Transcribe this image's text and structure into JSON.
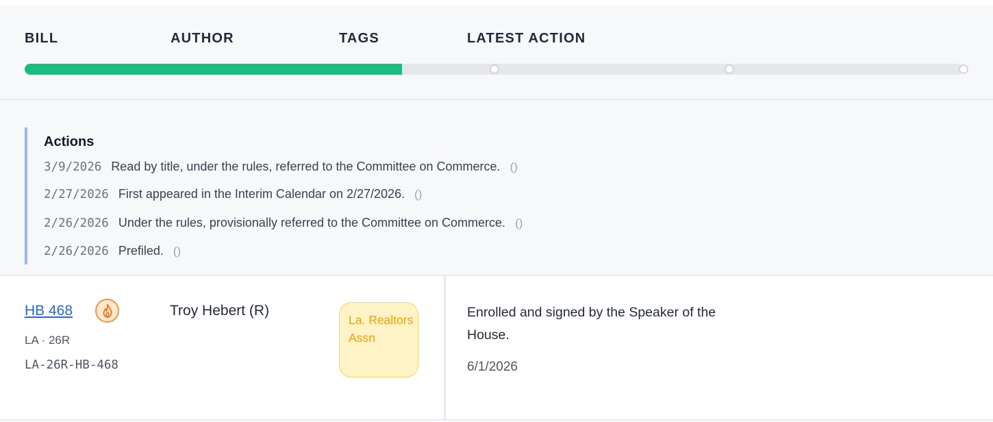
{
  "table": {
    "headers": {
      "bill": "BILL",
      "author": "AUTHOR",
      "tags": "TAGS",
      "latest_action": "LATEST ACTION"
    }
  },
  "progress": {
    "fraction": 0.402,
    "stage_markers": 3,
    "colors": {
      "fill": "#1abd7d",
      "track": "#e6e7ec"
    }
  },
  "actions": {
    "title": "Actions",
    "items": [
      {
        "date": "3/9/2026",
        "text": "Read by title, under the rules, referred to the Committee on Commerce.",
        "paren": "()"
      },
      {
        "date": "2/27/2026",
        "text": "First appeared in the Interim Calendar on 2/27/2026.",
        "paren": "()"
      },
      {
        "date": "2/26/2026",
        "text": "Under the rules, provisionally referred to the Committee on Commerce.",
        "paren": "()"
      },
      {
        "date": "2/26/2026",
        "text": "Prefiled.",
        "paren": "()"
      }
    ]
  },
  "bill_row": {
    "bill_number": "HB 468",
    "hot_icon": "flame-icon",
    "meta": "LA · 26R",
    "bill_id": "LA-26R-HB-468",
    "author": "Troy Hebert (R)",
    "tag": "La. Realtors Assn",
    "latest_action": "Enrolled and signed by the Speaker of the House.",
    "latest_date": "6/1/2026",
    "colors": {
      "link": "#2563eb",
      "tag_text": "#f59e0b",
      "tag_bg": "#fef3c7",
      "hot": "#fb923c"
    }
  }
}
